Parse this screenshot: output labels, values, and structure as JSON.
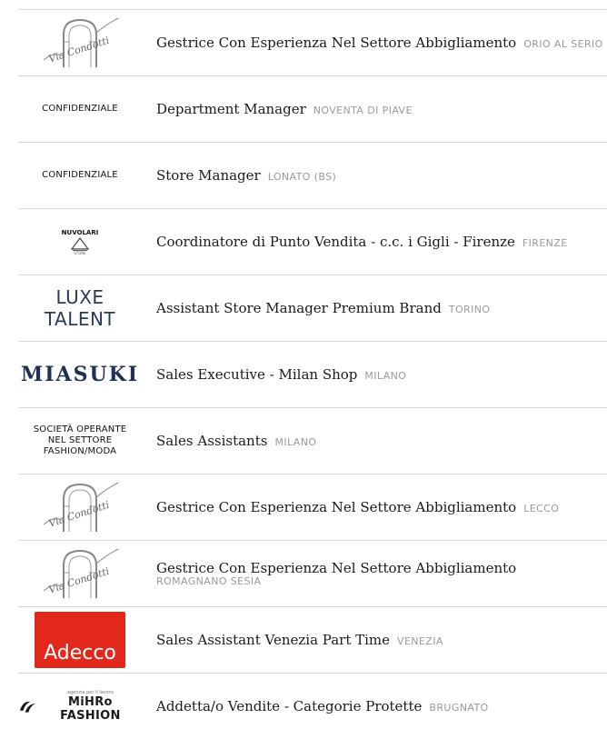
{
  "jobs": [
    {
      "logo": {
        "kind": "image",
        "name": "via-condotti-logo",
        "text": "Via Condotti"
      },
      "title": "Gestrice Con Esperienza Nel Settore Abbigliamento",
      "location": "ORIO AL SERIO"
    },
    {
      "logo": {
        "kind": "text",
        "text": "CONFIDENZIALE"
      },
      "title": "Department Manager",
      "location": "NOVENTA DI PIAVE"
    },
    {
      "logo": {
        "kind": "text",
        "text": "CONFIDENZIALE"
      },
      "title": "Store Manager",
      "location": "LONATO (BS)"
    },
    {
      "logo": {
        "kind": "image",
        "name": "nuvolari-logo",
        "text": "NUVOLARI",
        "subtext": "STORE"
      },
      "title": "Coordinatore di Punto Vendita - c.c. i Gigli - Firenze",
      "location": "FIRENZE"
    },
    {
      "logo": {
        "kind": "image",
        "name": "luxe-talent-logo",
        "text": "LUXE TALENT"
      },
      "title": "Assistant Store Manager Premium Brand",
      "location": "TORINO"
    },
    {
      "logo": {
        "kind": "image",
        "name": "miasuki-logo",
        "text": "MIASUKI"
      },
      "title": "Sales Executive - Milan Shop",
      "location": "MILANO"
    },
    {
      "logo": {
        "kind": "text",
        "text": "SOCIETÀ OPERANTE NEL SETTORE FASHION/MODA"
      },
      "title": "Sales Assistants",
      "location": "MILANO"
    },
    {
      "logo": {
        "kind": "image",
        "name": "via-condotti-logo",
        "text": "Via Condotti"
      },
      "title": "Gestrice Con Esperienza Nel Settore Abbigliamento",
      "location": "LECCO"
    },
    {
      "logo": {
        "kind": "image",
        "name": "via-condotti-logo",
        "text": "Via Condotti"
      },
      "title": "Gestrice Con Esperienza Nel Settore Abbigliamento",
      "location": "ROMAGNANO SESIA"
    },
    {
      "logo": {
        "kind": "image",
        "name": "adecco-logo",
        "text": "Adecco"
      },
      "title": "Sales Assistant Venezia Part Time",
      "location": "VENEZIA"
    },
    {
      "logo": {
        "kind": "image",
        "name": "mihro-fashion-logo",
        "text": "MiHRo FASHION",
        "subtext": "agenzia per il lavoro"
      },
      "title": "Addetta/o Vendite - Categorie Protette",
      "location": "BRUGNATO"
    }
  ],
  "colors": {
    "divider": "#d9d9d9",
    "location": "#9a9a9a",
    "adecco": "#e2281b",
    "brand_navy": "#1f2f55"
  }
}
